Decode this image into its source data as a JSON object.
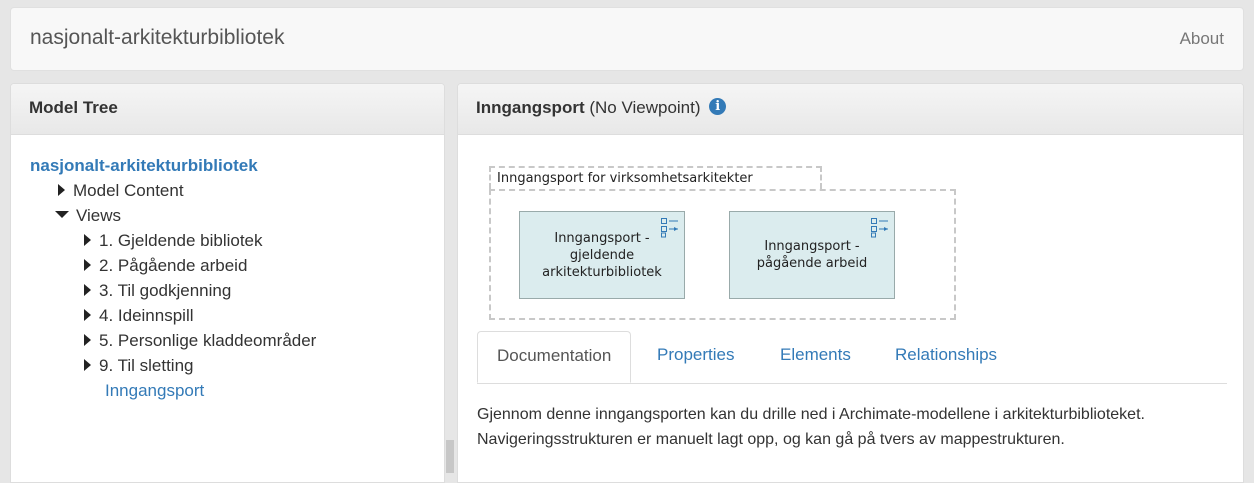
{
  "navbar": {
    "brand": "nasjonalt-arkitekturbibliotek",
    "about": "About"
  },
  "left_panel": {
    "heading": "Model Tree",
    "root": "nasjonalt-arkitekturbibliotek",
    "model_content": "Model Content",
    "views": "Views",
    "folders": [
      "1. Gjeldende bibliotek",
      "2. Pågående arbeid",
      "3. Til godkjenning",
      "4. Ideinnspill",
      "5. Personlige kladdeområder",
      "9. Til sletting"
    ],
    "current_view": "Inngangsport"
  },
  "right_panel": {
    "title": "Inngangsport",
    "viewpoint": "(No Viewpoint)",
    "info_icon": "i",
    "diagram": {
      "group_label": "Inngangsport for virksomhetsarkitekter",
      "elements": [
        "Inngangsport -\ngjeldende\narkitekturbibliotek",
        "Inngangsport -\npågående arbeid"
      ]
    },
    "tabs": [
      "Documentation",
      "Properties",
      "Elements",
      "Relationships"
    ],
    "active_tab": "Documentation",
    "documentation": "Gjennom denne inngangsporten kan du drille ned i Archimate-modellene i arkitekturbiblioteket. Navigeringsstrukturen er manuelt lagt opp, og kan gå på tvers av mappestrukturen."
  },
  "colors": {
    "link": "#337ab7",
    "element_fill": "#dbecee",
    "element_icon": "#337ab7"
  }
}
